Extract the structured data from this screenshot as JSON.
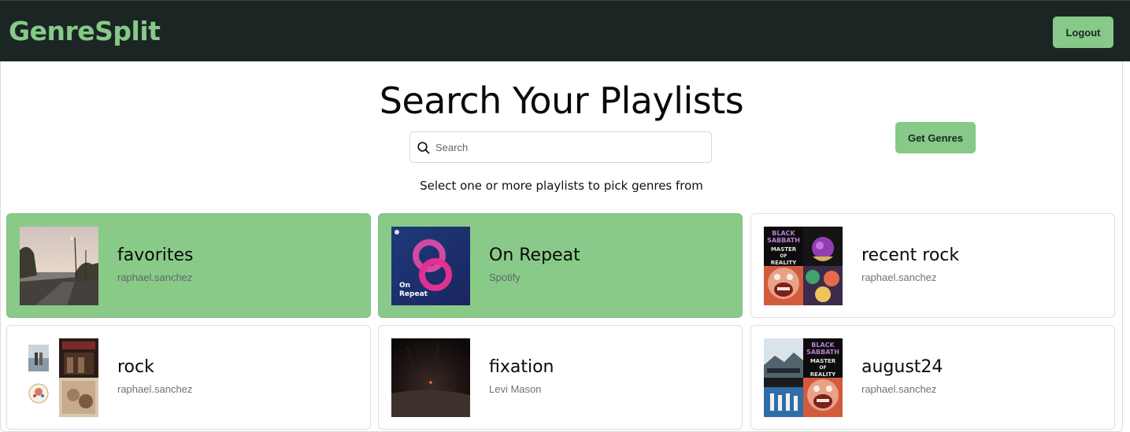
{
  "brand": "GenreSplit",
  "nav": {
    "logout_label": "Logout"
  },
  "page": {
    "title": "Search Your Playlists",
    "search_placeholder": "Search",
    "get_genres_label": "Get Genres",
    "hint": "Select one or more playlists to pick genres from"
  },
  "colors": {
    "accent": "#86c988",
    "navbar": "#1b2624",
    "selected_card": "#89ca89"
  },
  "playlists": [
    {
      "name": "favorites",
      "owner": "raphael.sanchez",
      "selected": true
    },
    {
      "name": "On Repeat",
      "owner": "Spotify",
      "selected": true,
      "cover_text": "On Repeat"
    },
    {
      "name": "recent rock",
      "owner": "raphael.sanchez",
      "selected": false,
      "cover_text": [
        "BLACK SABBATH",
        "MASTER OF REALITY"
      ]
    },
    {
      "name": "rock",
      "owner": "raphael.sanchez",
      "selected": false
    },
    {
      "name": "fixation",
      "owner": "Levi Mason",
      "selected": false
    },
    {
      "name": "august24",
      "owner": "raphael.sanchez",
      "selected": false,
      "cover_text": [
        "BLACK SABBATH",
        "MASTER OF REALITY"
      ]
    }
  ]
}
